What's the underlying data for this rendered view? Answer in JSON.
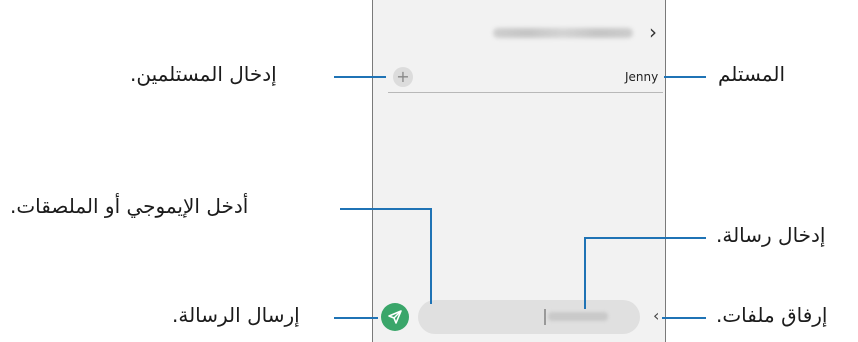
{
  "phone": {
    "recipient_name": "Jenny",
    "back_icon": "chevron-left-icon",
    "add_icon": "plus-icon",
    "emoji_icon": "smiley-icon",
    "send_icon": "paper-plane-icon",
    "attach_icon": "chevron-left-icon",
    "send_color": "#3aa66a"
  },
  "callouts": {
    "recipient": "المستلم",
    "enter_recipients": "إدخال المستلمين.",
    "enter_message": "إدخال رسالة.",
    "emoji_stickers": "أدخل الإيموجي أو الملصقات.",
    "attach_files": "إرفاق ملفات.",
    "send_message": "إرسال الرسالة."
  },
  "accent_color": "#1f73b5"
}
